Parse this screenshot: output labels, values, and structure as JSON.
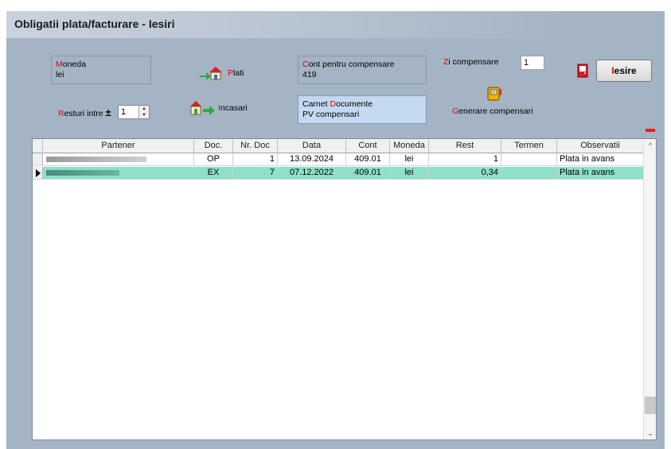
{
  "window": {
    "title": "Obligatii plata/facturare - Iesiri"
  },
  "moneda": {
    "first_letter": "M",
    "rest": "oneda",
    "value": "lei"
  },
  "plati": {
    "first_letter": "P",
    "rest": "lati"
  },
  "cont_compensare": {
    "first_letter": "C",
    "rest": "ont pentru compensare",
    "value": "419"
  },
  "zi_compensare": {
    "first_letter": "Z",
    "rest": "i compensare",
    "value": "1"
  },
  "iesire": {
    "first_letter": "I",
    "rest": "esire"
  },
  "resturi": {
    "first_letter": "R",
    "rest": "esturi intre",
    "sign": "±",
    "value": "1"
  },
  "incasari": {
    "first_letter": "I",
    "rest": "ncasari"
  },
  "carnet": {
    "part1": "Carnet ",
    "first_letter": "D",
    "rest": "ocumente",
    "value": "PV compensari"
  },
  "generare": {
    "first_letter": "G",
    "rest": "enerare compensari"
  },
  "grid": {
    "headers": [
      "Partener",
      "Doc.",
      "Nr. Doc",
      "Data",
      "Cont",
      "Moneda",
      "Rest",
      "Termen",
      "Observatii"
    ],
    "rows": [
      {
        "partener": "",
        "doc": "OP",
        "nr": "1",
        "data": "13.09.2024",
        "cont": "409.01",
        "moneda": "lei",
        "rest": "1",
        "termen": "",
        "obs": "Plata in avans"
      },
      {
        "partener": "",
        "doc": "EX",
        "nr": "7",
        "data": "07.12.2022",
        "cont": "409.01",
        "moneda": "lei",
        "rest": "0,34",
        "termen": "",
        "obs": "Plata in avans"
      }
    ],
    "selected_row": 1
  },
  "colors": {
    "window_bg": "#a4b4c4",
    "selected_row": "#8ee0c8",
    "accent_red": "#e00000"
  },
  "icons": [
    "door-exit-icon",
    "houses-payment-icon",
    "houses-receipt-icon",
    "compensation-machine-icon",
    "row-pointer-icon"
  ]
}
